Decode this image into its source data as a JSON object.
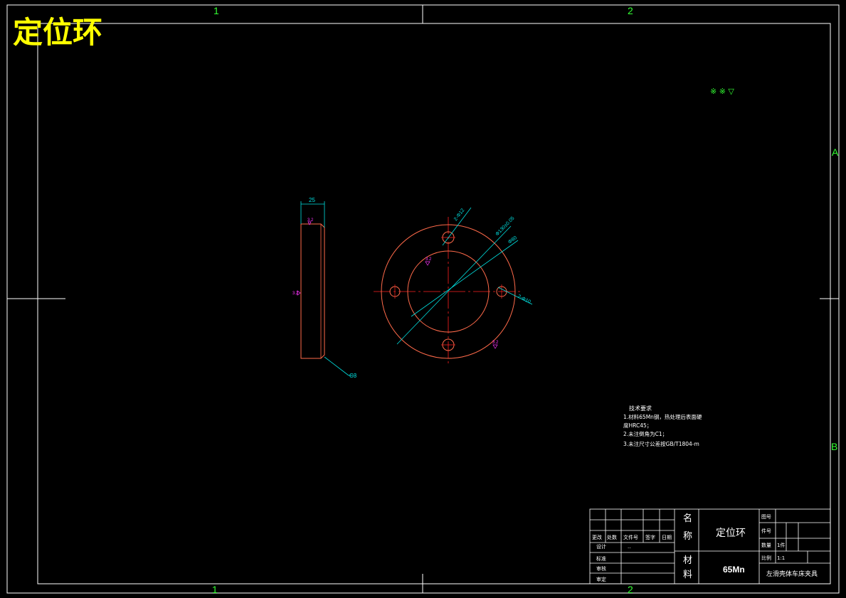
{
  "drawing": {
    "title": "定位环",
    "zone_labels": {
      "col_1": "1",
      "col_2": "2",
      "row_a": "A",
      "row_b": "B"
    },
    "roughness_symbol": "※ ※ ▽",
    "colors": {
      "background": "#000000",
      "frame": "#ffffff",
      "part_outline": "#ff6a4a",
      "centerline": "#ff2020",
      "dimension": "#00e0e0",
      "title_text": "#ffff00",
      "zone_text": "#33ff33",
      "roughness": "#ff33ff"
    }
  },
  "side_view": {
    "width_dim": "25",
    "chamfer_label": "C3",
    "roughness_top": "3.2",
    "roughness_side": "3.2"
  },
  "front_view": {
    "dim_small_hole": "2-Φ12",
    "dim_bolt_circle": "Φ130±0.05",
    "dim_outer": "Φ80",
    "dim_side_hole": "2-Φ10",
    "roughness_1": "3.2",
    "roughness_2": "3.2"
  },
  "tech_requirements": {
    "heading": "技术要求",
    "lines": [
      "1.材料65Mn钢，热处理后表面硬",
      "度HRC45；",
      "2.未注倒角为C1；",
      "3.未注尺寸公差按GB/T1804-m"
    ]
  },
  "title_block": {
    "name_label_1": "名",
    "name_label_2": "称",
    "part_name": "定位环",
    "material_label_1": "材",
    "material_label_2": "料",
    "material": "65Mn",
    "assembly": "左滑壳体车床夹具",
    "drawing_no_label": "图号",
    "part_no_label": "件号",
    "qty_label": "数量",
    "qty_value": "1件",
    "scale_label": "比例",
    "scale_value": "1:1",
    "rev_headers": [
      "更改",
      "处数",
      "文件号",
      "签字",
      "日期"
    ],
    "design_label": "设计",
    "design_value": "..",
    "check_label": "标准",
    "review_label": "审核",
    "approve_label": "审定"
  }
}
